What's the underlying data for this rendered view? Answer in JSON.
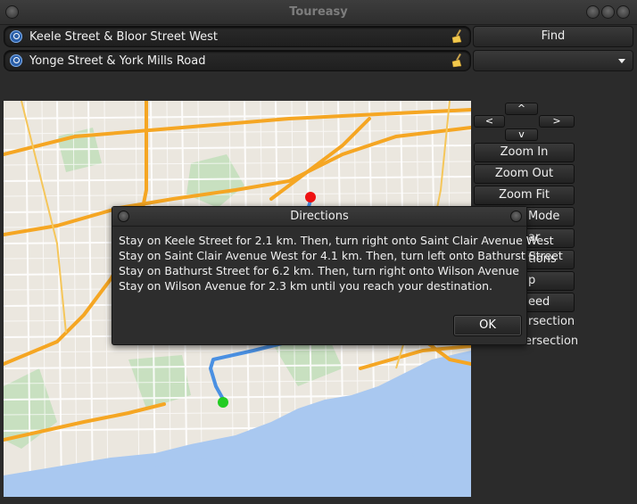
{
  "window": {
    "title": "Toureasy"
  },
  "search": {
    "start": {
      "value": "Keele Street & Bloor Street West"
    },
    "end": {
      "value": "Yonge Street & York Mills Road"
    }
  },
  "find_label": "Find",
  "nav": {
    "up": "^",
    "down": "v",
    "left": "<",
    "right": ">"
  },
  "panel": {
    "zoom_in": "Zoom In",
    "zoom_out": "Zoom Out",
    "zoom_fit": "Zoom Fit",
    "mode": "Mode",
    "clear": "ar",
    "directions": "tions",
    "help": "p",
    "speed": "eed",
    "start_intersection": "rsection",
    "end_intersection": "End Intersection"
  },
  "dialog": {
    "title": "Directions",
    "lines": [
      "Stay on Keele Street for 2.1 km. Then, turn right onto Saint Clair Avenue West",
      "Stay on Saint Clair Avenue West for 4.1 km. Then, turn left onto Bathurst Street",
      "Stay on Bathurst Street for 6.2 km. Then, turn right onto Wilson Avenue",
      "Stay on Wilson Avenue for 2.3 km until you reach your destination."
    ],
    "ok_label": "OK"
  },
  "colors": {
    "route": "#4a90e2",
    "start_marker": "#22cc22",
    "end_marker": "#ee1111",
    "highway": "#f5a623",
    "water": "#a9c8f0",
    "park": "#c8e0c0"
  }
}
